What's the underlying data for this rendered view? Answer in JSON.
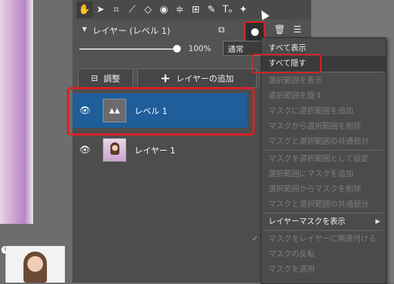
{
  "toolbar": {
    "tools": [
      "hand-icon",
      "arrow-icon",
      "crop-icon",
      "straighten-icon",
      "lasso-icon",
      "eye-icon",
      "strikethrough-icon",
      "grid-icon",
      "brush-icon",
      "text-icon",
      "sparkle-icon"
    ],
    "glyphs": [
      "✋",
      "➤",
      "⌗",
      "⟋",
      "◇",
      "◉",
      "≑",
      "⊞",
      "✎",
      "Tₒ",
      "✦"
    ]
  },
  "layers_panel": {
    "title": "レイヤー (レベル 1)",
    "opacity": "100%",
    "blend_mode": "通常",
    "adjust_label": "調整",
    "add_layer_label": "レイヤーの追加",
    "layers": [
      {
        "name": "レベル 1",
        "thumb": "levels",
        "active": true
      },
      {
        "name": "レイヤー 1",
        "thumb": "photo",
        "active": false
      }
    ]
  },
  "mask_menu": {
    "groups": [
      [
        {
          "label": "すべて表示",
          "enabled": true
        },
        {
          "label": "すべて隠す",
          "enabled": true,
          "highlighted": true
        }
      ],
      [
        {
          "label": "選択範囲を表示",
          "enabled": false
        },
        {
          "label": "選択範囲を隠す",
          "enabled": false
        },
        {
          "label": "マスクに選択範囲を追加",
          "enabled": false
        },
        {
          "label": "マスクから選択範囲を削除",
          "enabled": false
        },
        {
          "label": "マスクと選択範囲の共通部分",
          "enabled": false
        }
      ],
      [
        {
          "label": "マスクを選択範囲として設定",
          "enabled": false
        },
        {
          "label": "選択範囲にマスクを追加",
          "enabled": false
        },
        {
          "label": "選択範囲からマスクを削除",
          "enabled": false
        },
        {
          "label": "マスクと選択範囲の共通部分",
          "enabled": false
        }
      ],
      [
        {
          "label": "レイヤーマスクを表示",
          "enabled": true,
          "submenu": true
        }
      ],
      [
        {
          "label": "マスクをレイヤーに関連付ける",
          "enabled": false,
          "checked": true
        },
        {
          "label": "マスクの反転",
          "enabled": false
        },
        {
          "label": "マスクを適用",
          "enabled": false
        }
      ]
    ]
  },
  "colors": {
    "selection": "#1f5d9b",
    "annotation_red": "#e02020",
    "panel": "#535353"
  }
}
